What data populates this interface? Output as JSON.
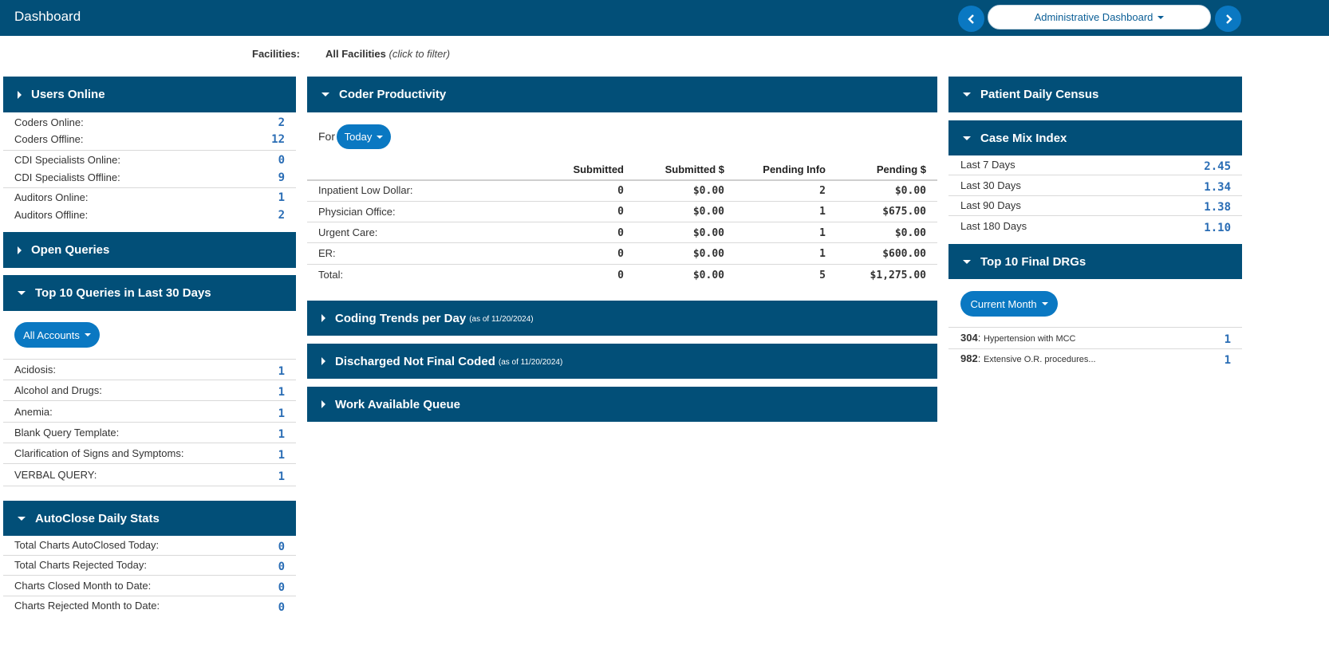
{
  "header": {
    "title": "Dashboard",
    "dashboard_select": "Administrative Dashboard",
    "prev_icon": "chevron-left-icon",
    "next_icon": "chevron-right-icon"
  },
  "facilities": {
    "label": "Facilities:",
    "value": "All Facilities",
    "hint": "(click to filter)"
  },
  "users_online": {
    "title": "Users Online",
    "rows": [
      {
        "label": "Coders Online:",
        "value": "2"
      },
      {
        "label": "Coders Offline:",
        "value": "12"
      },
      {
        "label": "CDI Specialists Online:",
        "value": "0"
      },
      {
        "label": "CDI Specialists Offline:",
        "value": "9"
      },
      {
        "label": "Auditors Online:",
        "value": "1"
      },
      {
        "label": "Auditors Offline:",
        "value": "2"
      }
    ]
  },
  "open_queries": {
    "title": "Open Queries"
  },
  "top_queries": {
    "title": "Top 10 Queries in Last 30 Days",
    "filter": "All Accounts",
    "rows": [
      {
        "label": "Acidosis:",
        "value": "1"
      },
      {
        "label": "Alcohol and Drugs:",
        "value": "1"
      },
      {
        "label": "Anemia:",
        "value": "1"
      },
      {
        "label": "Blank Query Template:",
        "value": "1"
      },
      {
        "label": "Clarification of Signs and Symptoms:",
        "value": "1"
      },
      {
        "label": "VERBAL QUERY:",
        "value": "1"
      }
    ]
  },
  "autoclose": {
    "title": "AutoClose Daily Stats",
    "rows": [
      {
        "label": "Total Charts AutoClosed Today:",
        "value": "0"
      },
      {
        "label": "Total Charts Rejected Today:",
        "value": "0"
      },
      {
        "label": "Charts Closed Month to Date:",
        "value": "0"
      },
      {
        "label": "Charts Rejected Month to Date:",
        "value": "0"
      }
    ]
  },
  "coder_productivity": {
    "title": "Coder Productivity",
    "for_label": "For",
    "period": "Today",
    "columns": [
      "Submitted",
      "Submitted $",
      "Pending Info",
      "Pending $"
    ],
    "rows": [
      {
        "label": "Inpatient Low Dollar:",
        "values": [
          "0",
          "$0.00",
          "2",
          "$0.00"
        ]
      },
      {
        "label": "Physician Office:",
        "values": [
          "0",
          "$0.00",
          "1",
          "$675.00"
        ]
      },
      {
        "label": "Urgent Care:",
        "values": [
          "0",
          "$0.00",
          "1",
          "$0.00"
        ]
      },
      {
        "label": "ER:",
        "values": [
          "0",
          "$0.00",
          "1",
          "$600.00"
        ]
      },
      {
        "label": "Total:",
        "values": [
          "0",
          "$0.00",
          "5",
          "$1,275.00"
        ]
      }
    ]
  },
  "coding_trends": {
    "title": "Coding Trends per Day",
    "note": "(as of 11/20/2024)"
  },
  "discharged": {
    "title": "Discharged Not Final Coded",
    "note": "(as of 11/20/2024)"
  },
  "work_queue": {
    "title": "Work Available Queue"
  },
  "census": {
    "title": "Patient Daily Census"
  },
  "case_mix": {
    "title": "Case Mix Index",
    "rows": [
      {
        "label": "Last 7 Days",
        "value": "2.45"
      },
      {
        "label": "Last 30 Days",
        "value": "1.34"
      },
      {
        "label": "Last 90 Days",
        "value": "1.38"
      },
      {
        "label": "Last 180 Days",
        "value": "1.10"
      }
    ]
  },
  "drgs": {
    "title": "Top 10 Final DRGs",
    "filter": "Current Month",
    "rows": [
      {
        "code": "304",
        "desc": "Hypertension with MCC",
        "value": "1"
      },
      {
        "code": "982",
        "desc": "Extensive O.R. procedures...",
        "value": "1"
      }
    ]
  }
}
